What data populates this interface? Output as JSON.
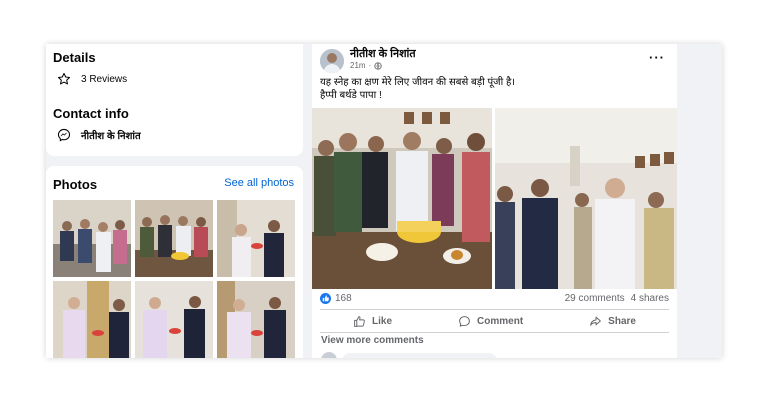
{
  "details": {
    "title": "Details",
    "reviews": "3 Reviews"
  },
  "contact": {
    "title": "Contact info",
    "messenger": "नीतीश के निशांत"
  },
  "photos": {
    "title": "Photos",
    "see_all": "See all photos"
  },
  "post": {
    "author": "नीतीश के निशांत",
    "time": "21m",
    "line1": "यह स्नेह का क्षण मेरे लिए जीवन की सबसे बड़ी पूंजी है।",
    "line2": "हैप्पी बर्थडे पापा !",
    "likes": "168",
    "comments": "29 comments",
    "shares": "4 shares",
    "like_label": "Like",
    "comment_label": "Comment",
    "share_label": "Share",
    "view_more": "View more comments"
  },
  "colors": {
    "link": "#0064d1",
    "like_blue": "#1877f2",
    "page_bg": "#f0f2f5"
  }
}
